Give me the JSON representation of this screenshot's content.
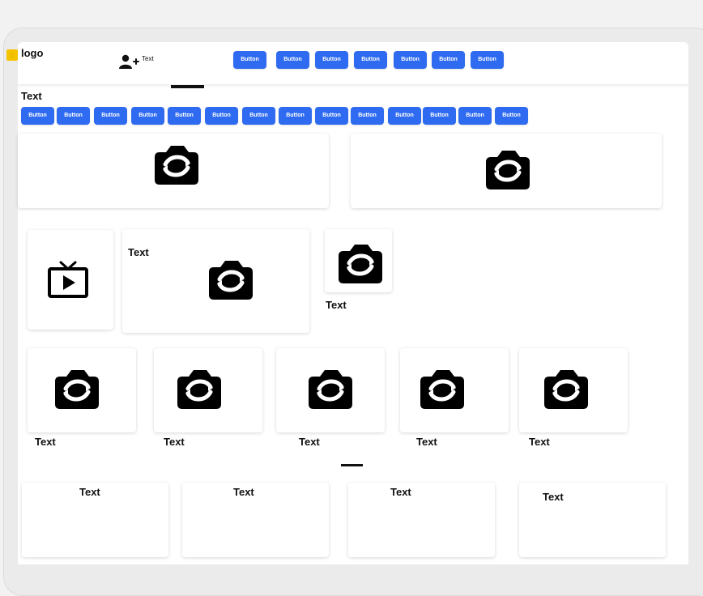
{
  "header": {
    "logo_text": "logo",
    "logo_icon": "logo-icon",
    "adduser_label": "Text",
    "nav_buttons": [
      "Button",
      "Button",
      "Button",
      "Button",
      "Button",
      "Button",
      "Button"
    ]
  },
  "toolbar": {
    "heading": "Text",
    "buttons": [
      "Button",
      "Button",
      "Button",
      "Button",
      "Button",
      "Button",
      "Button",
      "Button",
      "Button",
      "Button",
      "Button",
      "Button",
      "Button",
      "Button"
    ]
  },
  "row2": {
    "middle_card_label": "Text",
    "right_card_label": "Text"
  },
  "row3": {
    "labels": [
      "Text",
      "Text",
      "Text",
      "Text",
      "Text"
    ]
  },
  "row4": {
    "labels": [
      "Text",
      "Text",
      "Text",
      "Text"
    ]
  },
  "colors": {
    "accent": "#2f6bf0",
    "logo": "#f6c300"
  }
}
